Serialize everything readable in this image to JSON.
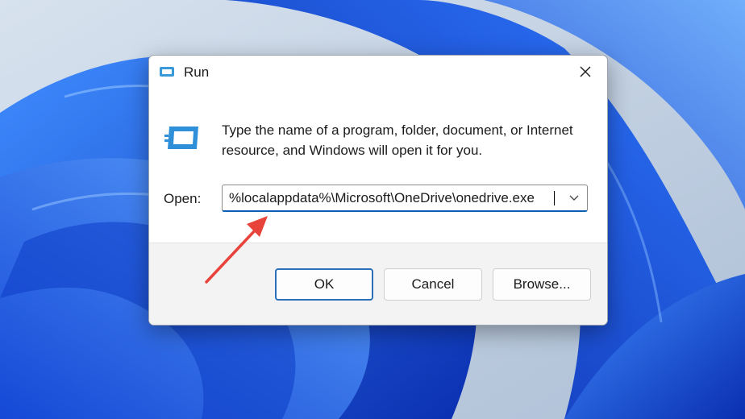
{
  "window": {
    "title": "Run",
    "icon": "run-app-icon",
    "close_icon": "close-icon"
  },
  "content": {
    "description": "Type the name of a program, folder, document, or Internet resource, and Windows will open it for you.",
    "open_label": "Open:",
    "open_value": "%localappdata%\\Microsoft\\OneDrive\\onedrive.exe",
    "dropdown_icon": "chevron-down-icon"
  },
  "buttons": {
    "ok": "OK",
    "cancel": "Cancel",
    "browse": "Browse..."
  },
  "annotation": {
    "type": "red-arrow",
    "color": "#e8433a"
  },
  "colors": {
    "accent": "#0a5fb4",
    "wallpaper_blue": "#1d5fe0"
  }
}
